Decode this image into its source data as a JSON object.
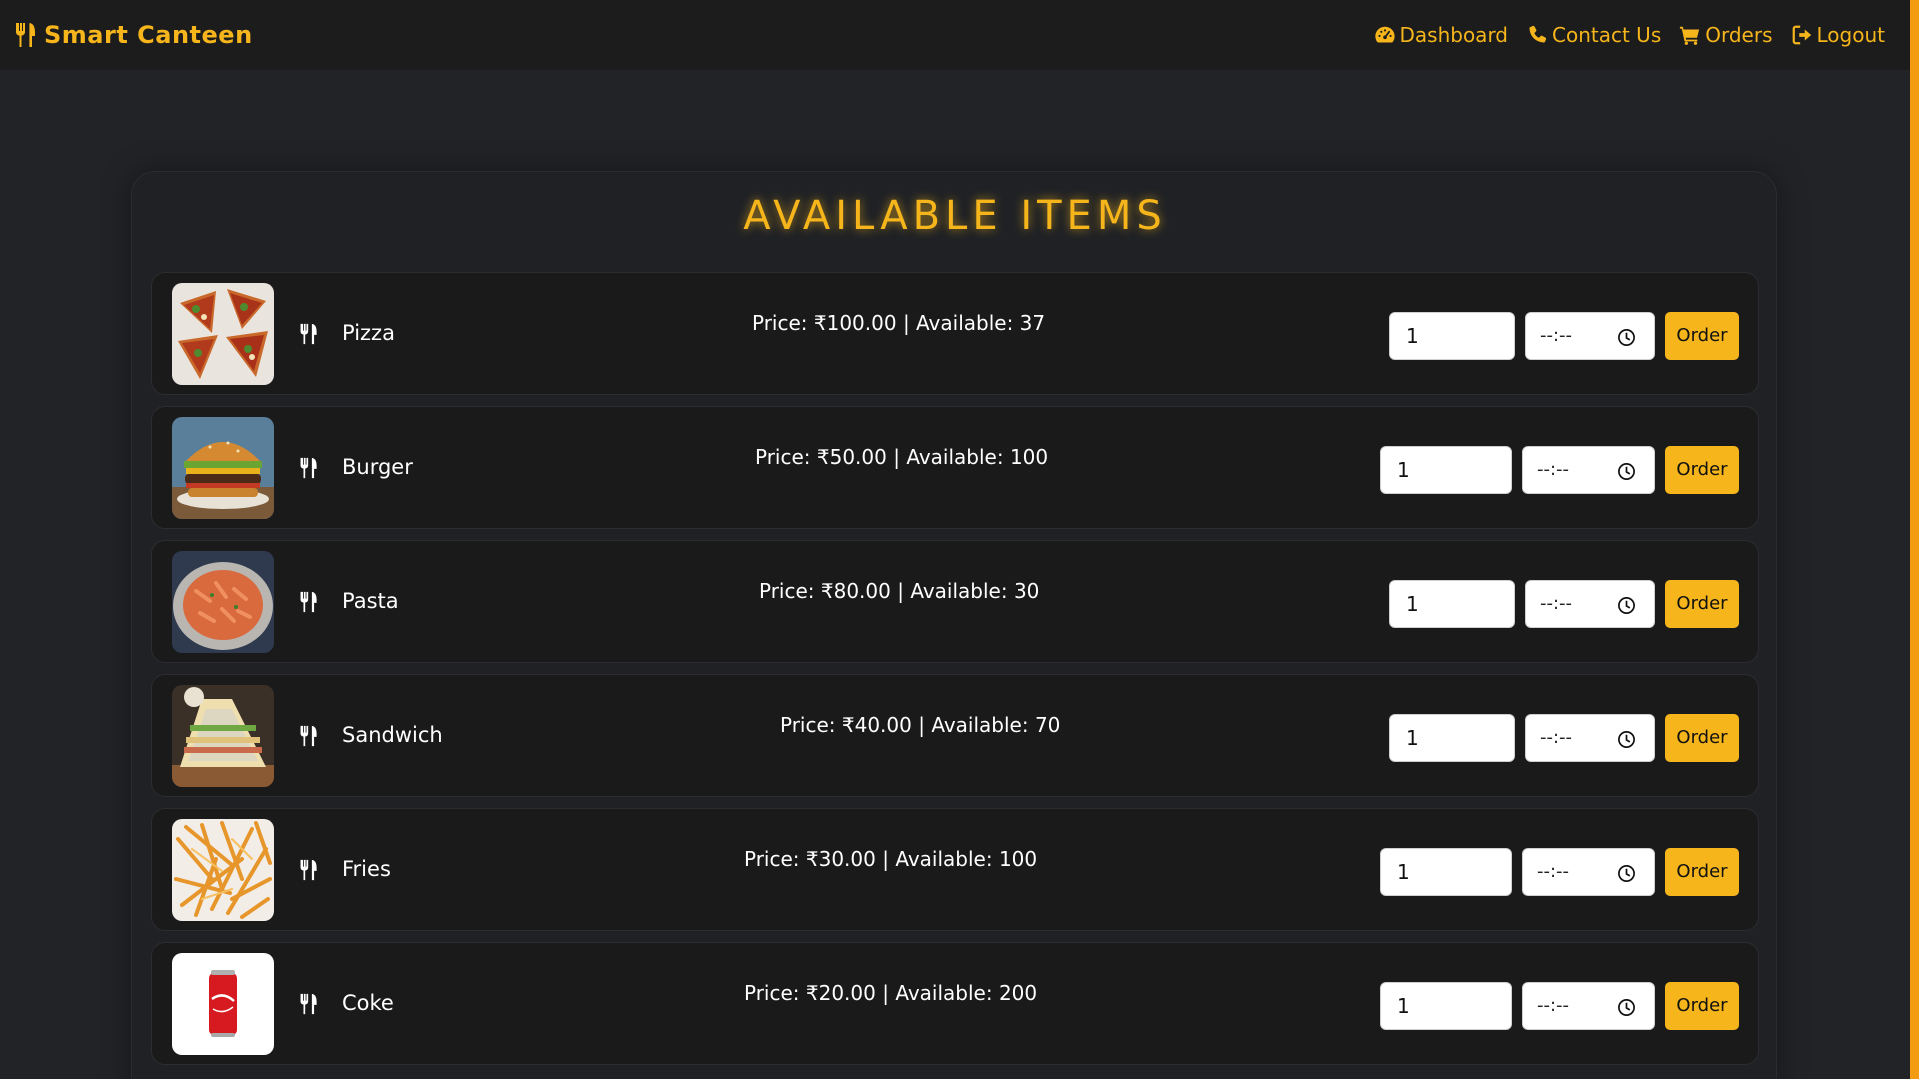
{
  "brand": {
    "name": "Smart Canteen",
    "icon": "utensils-icon"
  },
  "nav": [
    {
      "label": "Dashboard",
      "icon": "gauge-icon"
    },
    {
      "label": "Contact Us",
      "icon": "phone-icon"
    },
    {
      "label": "Orders",
      "icon": "cart-icon"
    },
    {
      "label": "Logout",
      "icon": "logout-icon"
    }
  ],
  "page_title": "AVAILABLE ITEMS",
  "items": [
    {
      "name": "Pizza",
      "info": "Price: ₹100.00 | Available: 37",
      "qty": "1",
      "time": "--:--",
      "order_label": "Order"
    },
    {
      "name": "Burger",
      "info": "Price: ₹50.00 | Available: 100",
      "qty": "1",
      "time": "--:--",
      "order_label": "Order"
    },
    {
      "name": "Pasta",
      "info": "Price: ₹80.00 | Available: 30",
      "qty": "1",
      "time": "--:--",
      "order_label": "Order"
    },
    {
      "name": "Sandwich",
      "info": "Price: ₹40.00 | Available: 70",
      "qty": "1",
      "time": "--:--",
      "order_label": "Order"
    },
    {
      "name": "Fries",
      "info": "Price: ₹30.00 | Available: 100",
      "qty": "1",
      "time": "--:--",
      "order_label": "Order"
    },
    {
      "name": "Coke",
      "info": "Price: ₹20.00 | Available: 200",
      "qty": "1",
      "time": "--:--",
      "order_label": "Order"
    }
  ],
  "colors": {
    "accent": "#f5b51b",
    "background": "#212327",
    "card": "#1a1a1b",
    "navbar": "#1c1c1d"
  }
}
